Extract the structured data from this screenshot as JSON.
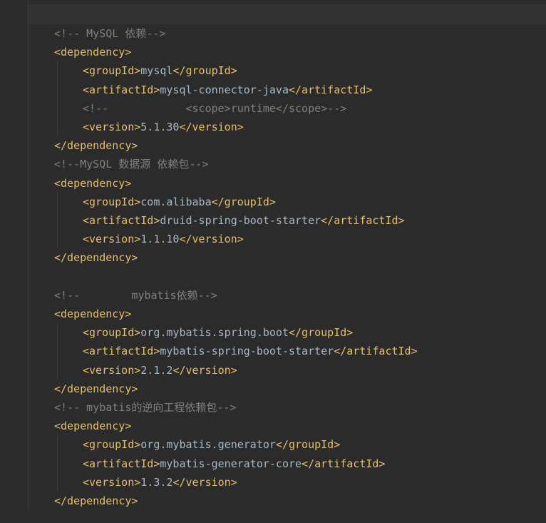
{
  "lines": [
    {
      "kind": "comment",
      "indent": 0,
      "text": "<!-- MySQL 依赖-->"
    },
    {
      "kind": "tag",
      "indent": 0,
      "text": "<dependency>"
    },
    {
      "kind": "element",
      "indent": 1,
      "open": "<groupId>",
      "value": "mysql",
      "close": "</groupId>"
    },
    {
      "kind": "element",
      "indent": 1,
      "open": "<artifactId>",
      "value": "mysql-connector-java",
      "close": "</artifactId>"
    },
    {
      "kind": "comment",
      "indent": 1,
      "text": "<!--            <scope>runtime</scope>-->"
    },
    {
      "kind": "element",
      "indent": 1,
      "open": "<version>",
      "value": "5.1.30",
      "close": "</version>"
    },
    {
      "kind": "tag",
      "indent": 0,
      "text": "</dependency>"
    },
    {
      "kind": "comment",
      "indent": 0,
      "text": "<!--MySQL 数据源 依赖包-->"
    },
    {
      "kind": "tag",
      "indent": 0,
      "text": "<dependency>"
    },
    {
      "kind": "element",
      "indent": 1,
      "open": "<groupId>",
      "value": "com.alibaba",
      "close": "</groupId>"
    },
    {
      "kind": "element",
      "indent": 1,
      "open": "<artifactId>",
      "value": "druid-spring-boot-starter",
      "close": "</artifactId>"
    },
    {
      "kind": "element",
      "indent": 1,
      "open": "<version>",
      "value": "1.1.10",
      "close": "</version>"
    },
    {
      "kind": "tag",
      "indent": 0,
      "text": "</dependency>"
    },
    {
      "kind": "blank",
      "indent": 0,
      "text": ""
    },
    {
      "kind": "comment",
      "indent": 0,
      "text": "<!--        mybatis依赖-->"
    },
    {
      "kind": "tag",
      "indent": 0,
      "text": "<dependency>"
    },
    {
      "kind": "element",
      "indent": 1,
      "open": "<groupId>",
      "value": "org.mybatis.spring.boot",
      "close": "</groupId>"
    },
    {
      "kind": "element",
      "indent": 1,
      "open": "<artifactId>",
      "value": "mybatis-spring-boot-starter",
      "close": "</artifactId>"
    },
    {
      "kind": "element",
      "indent": 1,
      "open": "<version>",
      "value": "2.1.2",
      "close": "</version>"
    },
    {
      "kind": "tag",
      "indent": 0,
      "text": "</dependency>"
    },
    {
      "kind": "comment",
      "indent": 0,
      "text": "<!-- mybatis的逆向工程依赖包-->"
    },
    {
      "kind": "tag",
      "indent": 0,
      "text": "<dependency>"
    },
    {
      "kind": "element",
      "indent": 1,
      "open": "<groupId>",
      "value": "org.mybatis.generator",
      "close": "</groupId>"
    },
    {
      "kind": "element",
      "indent": 1,
      "open": "<artifactId>",
      "value": "mybatis-generator-core",
      "close": "</artifactId>"
    },
    {
      "kind": "element",
      "indent": 1,
      "open": "<version>",
      "value": "1.3.2",
      "close": "</version>"
    },
    {
      "kind": "tag",
      "indent": 0,
      "text": "</dependency>"
    }
  ],
  "colors": {
    "background": "#2b2b2b",
    "tag": "#e8bf6a",
    "text": "#a9b7c6",
    "comment": "#808080"
  }
}
